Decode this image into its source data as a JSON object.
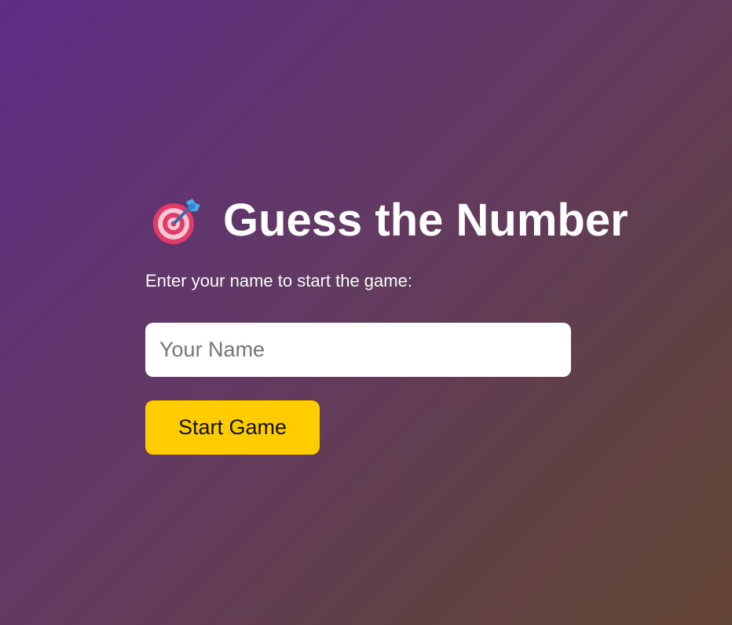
{
  "game": {
    "icon": "direct-hit-icon",
    "title": "Guess the Number",
    "subtitle": "Enter your name to start the game:",
    "name_placeholder": "Your Name",
    "name_value": "",
    "start_label": "Start Game"
  },
  "colors": {
    "gradient_start": "#5f2c86",
    "gradient_end": "#634534",
    "button_bg": "#ffcc00",
    "input_bg": "#ffffff",
    "text": "#ffffff"
  }
}
